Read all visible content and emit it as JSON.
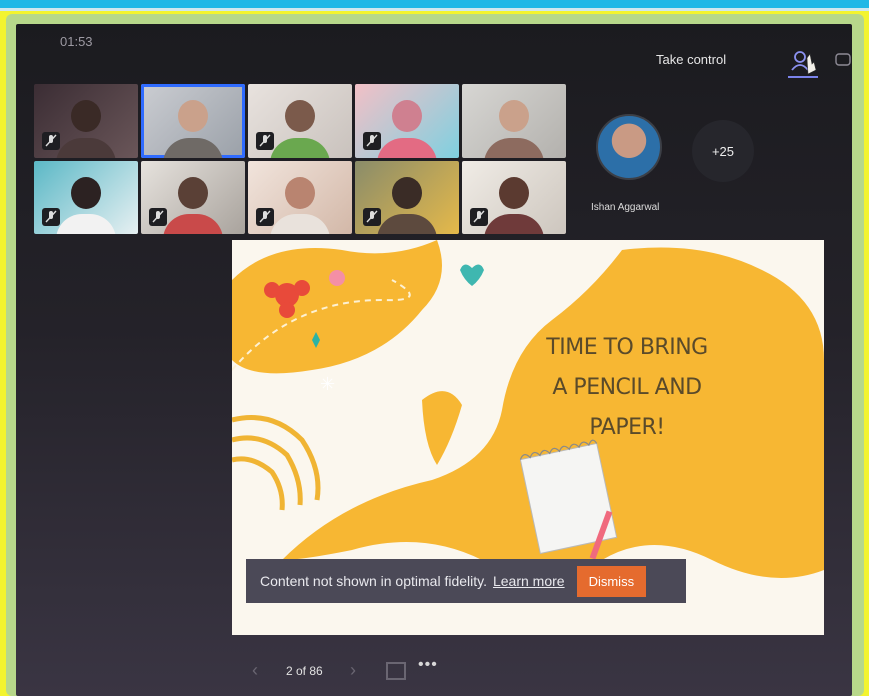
{
  "meeting": {
    "timer": "01:53",
    "take_control_label": "Take control"
  },
  "participants": {
    "grid": [
      {
        "id": "p1",
        "muted": true
      },
      {
        "id": "p2",
        "muted": false,
        "active": true
      },
      {
        "id": "p3",
        "muted": true
      },
      {
        "id": "p4",
        "muted": true
      },
      {
        "id": "p5",
        "muted": true
      },
      {
        "id": "p6",
        "muted": true
      },
      {
        "id": "p7",
        "muted": true
      },
      {
        "id": "p8",
        "muted": true
      },
      {
        "id": "p9",
        "muted": true
      },
      {
        "id": "p10",
        "muted": true
      }
    ],
    "featured_name": "Ishan Aggarwal",
    "overflow_count": "+25"
  },
  "slide": {
    "title_line1": "TIME TO BRING",
    "title_line2": "A PENCIL AND PAPER!"
  },
  "banner": {
    "message": "Content not shown in optimal fidelity.",
    "learn_more": "Learn more",
    "dismiss_label": "Dismiss"
  },
  "navigation": {
    "page_indicator": "2 of 86",
    "prev_icon": "chevron-left",
    "next_icon": "chevron-right",
    "more_icon": "ellipsis"
  },
  "colors": {
    "accent_blue": "#2f6bff",
    "dismiss": "#e56b2e",
    "slide_yellow": "#f7b733"
  }
}
